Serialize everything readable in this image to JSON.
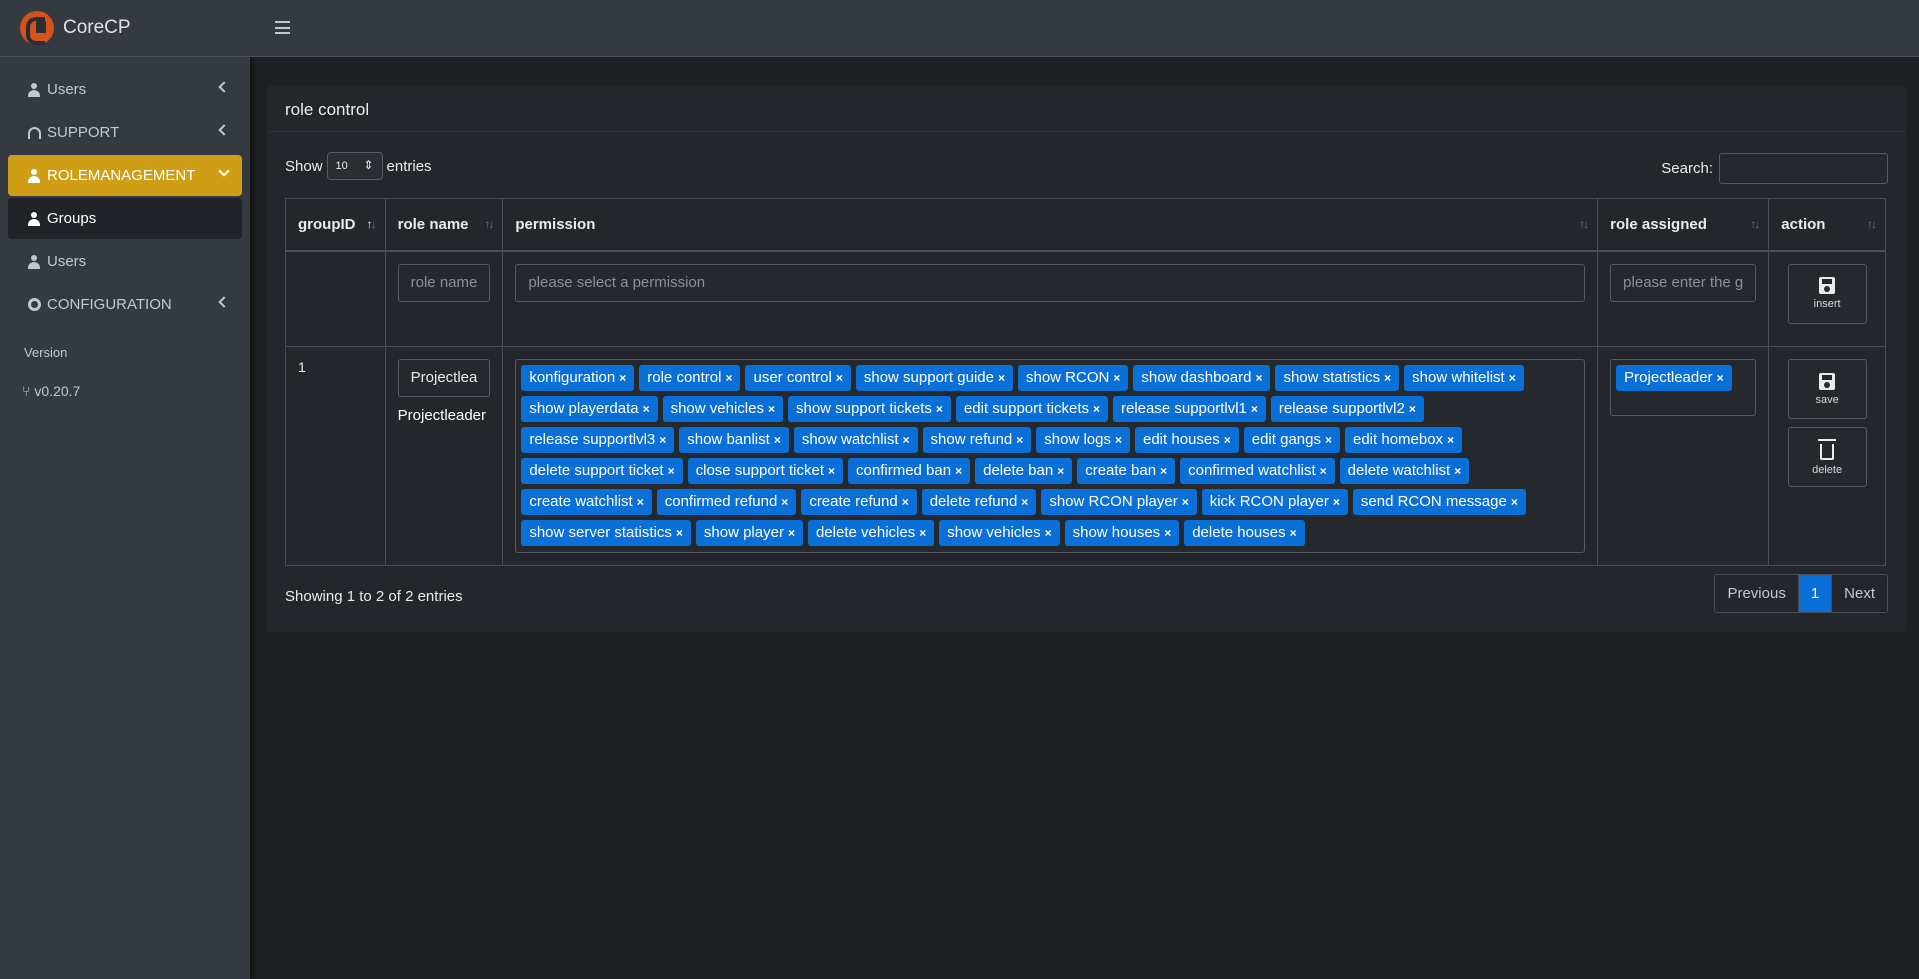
{
  "app": {
    "name": "CoreCP"
  },
  "sidebar": {
    "items": [
      {
        "label": "Users"
      },
      {
        "label": "SUPPORT"
      },
      {
        "label": "ROLEMANAGEMENT"
      },
      {
        "label": "Groups"
      },
      {
        "label": "Users"
      },
      {
        "label": "CONFIGURATION"
      }
    ],
    "version_heading": "Version",
    "version_value": "v0.20.7"
  },
  "card": {
    "title": "role control",
    "show_label": "Show",
    "entries_label": "entries",
    "page_length": "10",
    "search_label": "Search:"
  },
  "table": {
    "headers": [
      "groupID",
      "role name",
      "permission",
      "role assigned",
      "action"
    ],
    "insert_row": {
      "role_name_placeholder": "role name",
      "permission_placeholder": "please select a permission",
      "role_assigned_placeholder": "please enter the g",
      "insert_label": "insert"
    },
    "data_row": {
      "group_id": "1",
      "role_name_value": "Projectlea",
      "role_name_label": "Projectleader",
      "permissions": [
        "konfiguration",
        "role control",
        "user control",
        "show support guide",
        "show RCON",
        "show dashboard",
        "show statistics",
        "show whitelist",
        "show playerdata",
        "show vehicles",
        "show support tickets",
        "edit support tickets",
        "release supportlvl1",
        "release supportlvl2",
        "release supportlvl3",
        "show banlist",
        "show watchlist",
        "show refund",
        "show logs",
        "edit houses",
        "edit gangs",
        "edit homebox",
        "delete support ticket",
        "close support ticket",
        "confirmed ban",
        "delete ban",
        "create ban",
        "confirmed watchlist",
        "delete watchlist",
        "create watchlist",
        "confirmed refund",
        "create refund",
        "delete refund",
        "show RCON player",
        "kick RCON player",
        "send RCON message",
        "show server statistics",
        "show player",
        "delete vehicles",
        "show vehicles",
        "show houses",
        "delete houses"
      ],
      "role_assigned": "Projectleader",
      "save_label": "save",
      "delete_label": "delete"
    }
  },
  "footer": {
    "info": "Showing 1 to 2 of 2 entries",
    "previous": "Previous",
    "current_page": "1",
    "next": "Next"
  },
  "colors": {
    "accent": "#d09d16",
    "tag": "#0b6fd8",
    "logo": "#d4521c"
  }
}
